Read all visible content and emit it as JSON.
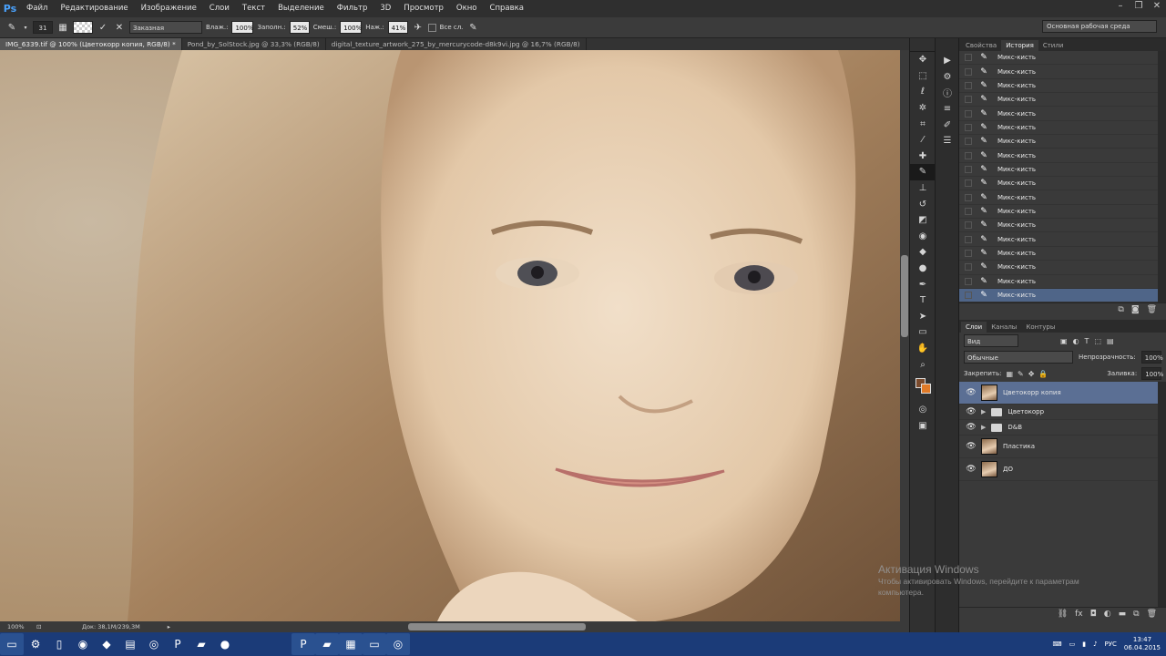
{
  "menubar": {
    "logo": "Ps",
    "items": [
      "Файл",
      "Редактирование",
      "Изображение",
      "Слои",
      "Текст",
      "Выделение",
      "Фильтр",
      "3D",
      "Просмотр",
      "Окно",
      "Справка"
    ]
  },
  "options": {
    "brush_size": "31",
    "mode": "Заказная",
    "wet_label": "Влаж.:",
    "wet_value": "100%",
    "load_label": "Заполн.:",
    "load_value": "52%",
    "mix_label": "Смеш.:",
    "mix_value": "100%",
    "flow_label": "Наж.:",
    "flow_value": "41%",
    "sample_all": "Все сл.",
    "workspace": "Основная рабочая среда"
  },
  "tabs": [
    "IMG_6339.tif @ 100% (Цветокорр копия, RGB/8) *",
    "Pond_by_SolStock.jpg @ 33,3% (RGB/8)",
    "digital_texture_artwork_275_by_mercurycode-d8k9vi.jpg @ 16,7% (RGB/8)"
  ],
  "status": {
    "zoom": "100%",
    "doc": "Док: 38,1M/239,3M"
  },
  "history": {
    "tabs": [
      "Свойства",
      "История",
      "Стили"
    ],
    "items": [
      "Микс-кисть",
      "Микс-кисть",
      "Микс-кисть",
      "Микс-кисть",
      "Микс-кисть",
      "Микс-кисть",
      "Микс-кисть",
      "Микс-кисть",
      "Микс-кисть",
      "Микс-кисть",
      "Микс-кисть",
      "Микс-кисть",
      "Микс-кисть",
      "Микс-кисть",
      "Микс-кисть",
      "Микс-кисть",
      "Микс-кисть",
      "Микс-кисть"
    ]
  },
  "layers": {
    "tabs": [
      "Слои",
      "Каналы",
      "Контуры"
    ],
    "filter": "Вид",
    "blend": "Обычные",
    "opacity_label": "Непрозрачность:",
    "opacity": "100%",
    "lock_label": "Закрепить:",
    "fill_label": "Заливка:",
    "fill": "100%",
    "items": [
      {
        "name": "Цветокорр копия",
        "kind": "image"
      },
      {
        "name": "Цветокорр",
        "kind": "group"
      },
      {
        "name": "D&B",
        "kind": "group"
      },
      {
        "name": "Пластика",
        "kind": "image"
      },
      {
        "name": "ДО",
        "kind": "image"
      }
    ]
  },
  "watermark": {
    "title": "Активация Windows",
    "line1": "Чтобы активировать Windows, перейдите к параметрам",
    "line2": "компьютера."
  },
  "taskbar": {
    "time": "13:47",
    "date": "06.04.2015",
    "lang": "РУС"
  },
  "colors": {
    "accent": "#4f6588",
    "taskbar": "#1b3b78"
  }
}
